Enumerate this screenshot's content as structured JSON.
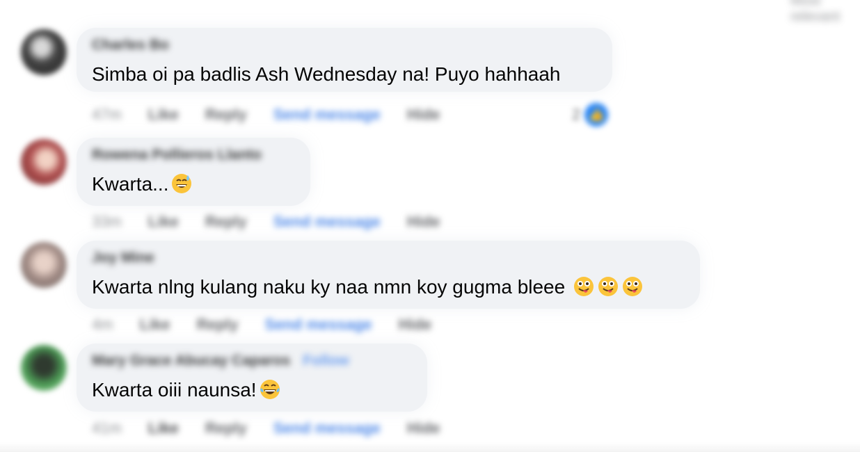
{
  "header": {
    "corner_text": "Most relevant"
  },
  "comments": [
    {
      "author": "Charles Bo",
      "text": "Simba oi pa badlis Ash Wednesday na! Puyo hahhaah",
      "emojis": [],
      "time": "47m",
      "like": "Like",
      "reply": "Reply",
      "send": "Send message",
      "hide": "Hide",
      "reaction_count": "2",
      "avatar_color": "#3b3b3b"
    },
    {
      "author": "Rowena Pollieros Llanto",
      "text": "Kwarta...",
      "emojis": [
        "grinning-sweat-emoji"
      ],
      "time": "33m",
      "like": "Like",
      "reply": "Reply",
      "send": "Send message",
      "hide": "Hide",
      "avatar_color": "#b86a6a"
    },
    {
      "author": "Joy Mine",
      "text": "Kwarta nlng kulang naku ky naa nmn koy gugma bleee ",
      "emojis": [
        "winking-tongue-emoji",
        "winking-tongue-emoji",
        "winking-tongue-emoji"
      ],
      "time": "4m",
      "like": "Like",
      "reply": "Reply",
      "send": "Send message",
      "hide": "Hide",
      "avatar_color": "#9c8a86"
    },
    {
      "author": "Mary Grace Abucay Caparos",
      "follow": "Follow",
      "text": "Kwarta oiii naunsa!",
      "emojis": [
        "tears-of-joy-emoji"
      ],
      "time": "41m",
      "like": "Like",
      "reply": "Reply",
      "send": "Send message",
      "hide": "Hide",
      "avatar_color": "#4c9a55"
    }
  ],
  "colors": {
    "bubble": "#f0f2f5",
    "link": "#4a86e8",
    "reaction": "#2b87f5"
  }
}
